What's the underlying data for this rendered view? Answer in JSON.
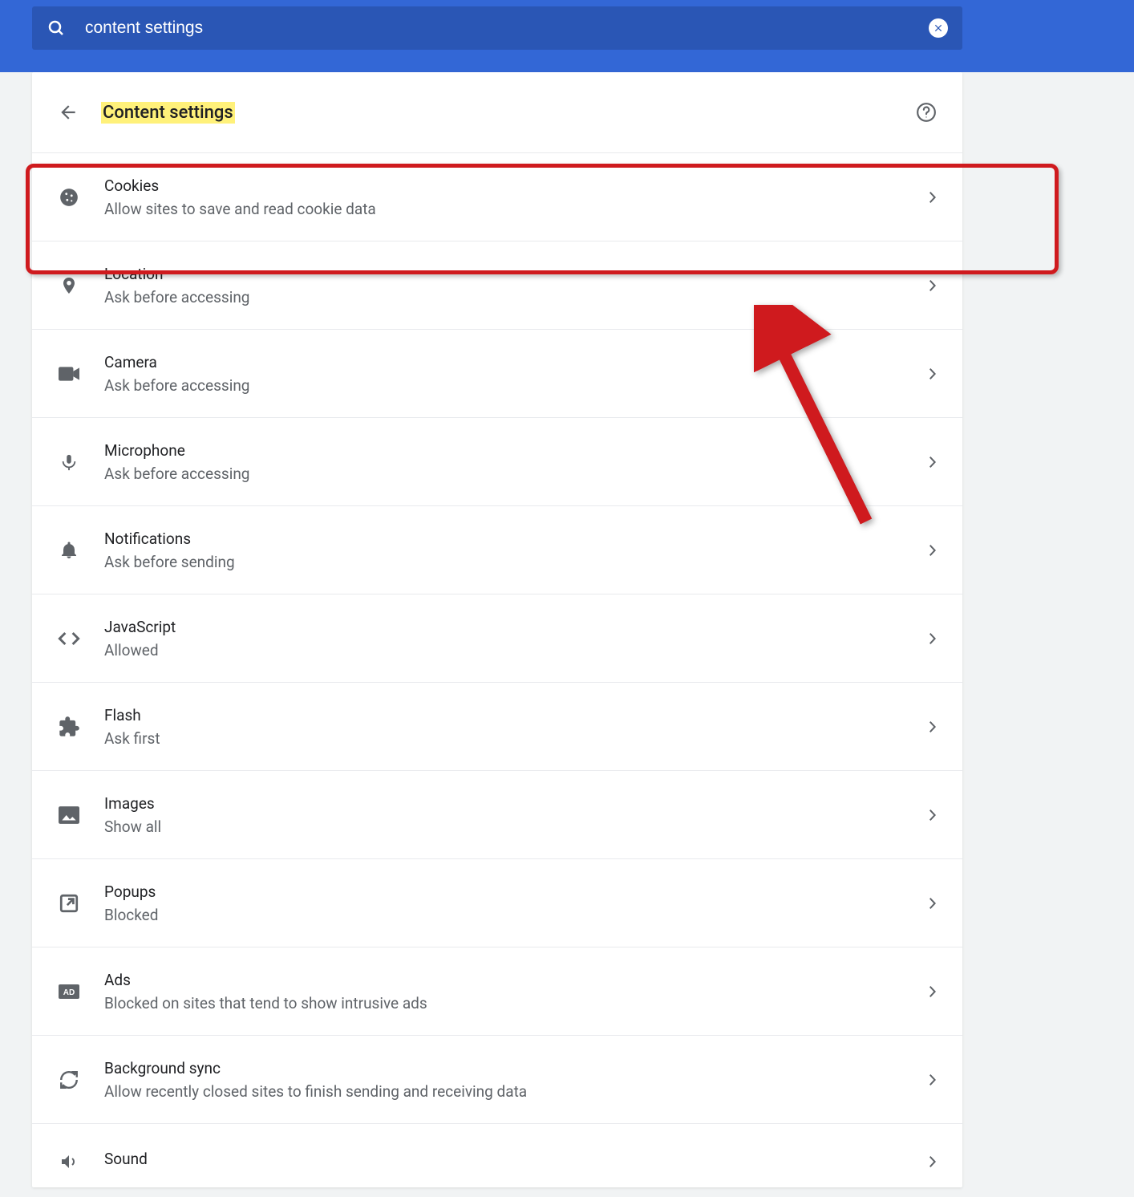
{
  "search": {
    "value": "content settings"
  },
  "page": {
    "title": "Content settings"
  },
  "rows": [
    {
      "title": "Cookies",
      "sub": "Allow sites to save and read cookie data"
    },
    {
      "title": "Location",
      "sub": "Ask before accessing"
    },
    {
      "title": "Camera",
      "sub": "Ask before accessing"
    },
    {
      "title": "Microphone",
      "sub": "Ask before accessing"
    },
    {
      "title": "Notifications",
      "sub": "Ask before sending"
    },
    {
      "title": "JavaScript",
      "sub": "Allowed"
    },
    {
      "title": "Flash",
      "sub": "Ask first"
    },
    {
      "title": "Images",
      "sub": "Show all"
    },
    {
      "title": "Popups",
      "sub": "Blocked"
    },
    {
      "title": "Ads",
      "sub": "Blocked on sites that tend to show intrusive ads"
    },
    {
      "title": "Background sync",
      "sub": "Allow recently closed sites to finish sending and receiving data"
    },
    {
      "title": "Sound",
      "sub": ""
    }
  ]
}
